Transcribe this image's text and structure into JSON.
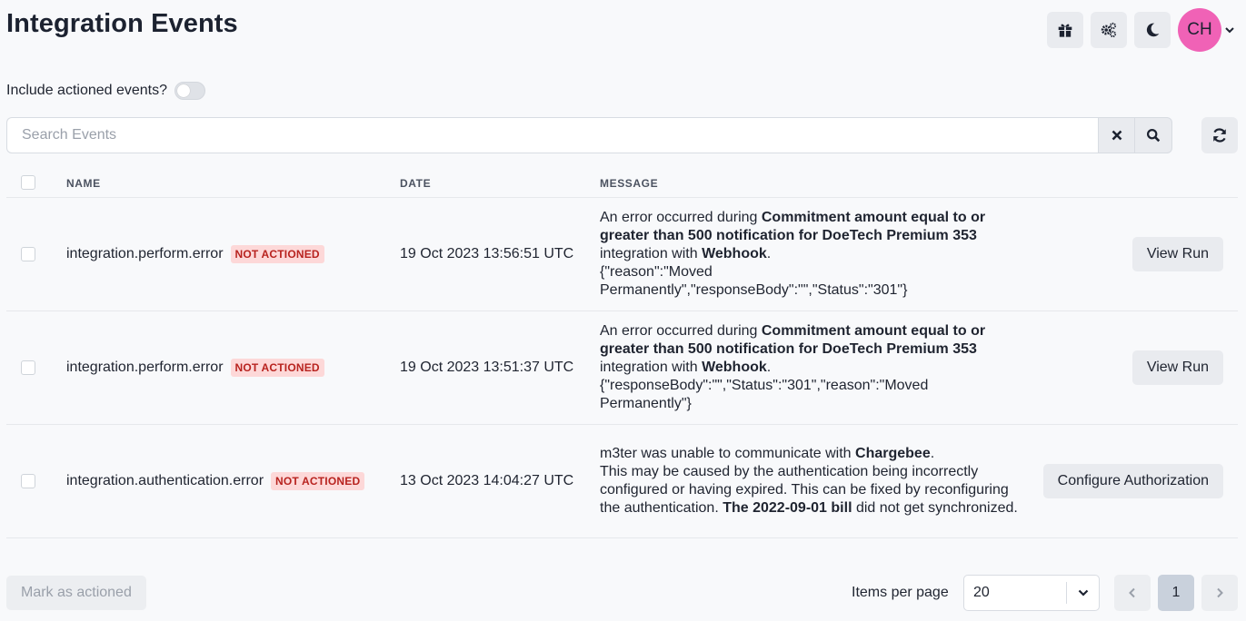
{
  "header": {
    "title": "Integration Events",
    "icons": [
      "gift-icon",
      "cogs-icon",
      "moon-icon"
    ],
    "avatar_initials": "CH",
    "avatar_color": "#f062b6"
  },
  "filter": {
    "toggle_label": "Include actioned events?",
    "toggle_on": false
  },
  "search": {
    "placeholder": "Search Events",
    "value": ""
  },
  "table": {
    "columns": [
      "NAME",
      "DATE",
      "MESSAGE"
    ],
    "rows": [
      {
        "name": "integration.perform.error",
        "badge": "NOT ACTIONED",
        "date": "19 Oct 2023 13:56:51 UTC",
        "msg": {
          "p1": "An error occurred during ",
          "b1": "Commitment amount equal to or greater than 500 notification for DoeTech Premium 353",
          "p2": " integration with ",
          "b2": "Webhook",
          "p3": ".",
          "p4": "{\"reason\":\"Moved Permanently\",\"responseBody\":\"\",\"Status\":\"301\"}"
        },
        "action": "View Run"
      },
      {
        "name": "integration.perform.error",
        "badge": "NOT ACTIONED",
        "date": "19 Oct 2023 13:51:37 UTC",
        "msg": {
          "p1": "An error occurred during ",
          "b1": "Commitment amount equal to or greater than 500 notification for DoeTech Premium 353",
          "p2": " integration with ",
          "b2": "Webhook",
          "p3": ".",
          "p4": "{\"responseBody\":\"\",\"Status\":\"301\",\"reason\":\"Moved Permanently\"}"
        },
        "action": "View Run"
      },
      {
        "name": "integration.authentication.error",
        "badge": "NOT ACTIONED",
        "date": "13 Oct 2023 14:04:27 UTC",
        "msg": {
          "p1": "m3ter was unable to communicate with ",
          "b1": "Chargebee",
          "p2": ".",
          "p3": "This may be caused by the authentication being incorrectly configured or having expired. This can be fixed by reconfiguring the authentication. ",
          "b2": "The 2022-09-01 bill",
          "p4": " did not get synchronized."
        },
        "action": "Configure Authorization"
      }
    ]
  },
  "footer": {
    "mark_label": "Mark as actioned",
    "items_per_page_label": "Items per page",
    "items_per_page_value": "20",
    "current_page": "1"
  }
}
